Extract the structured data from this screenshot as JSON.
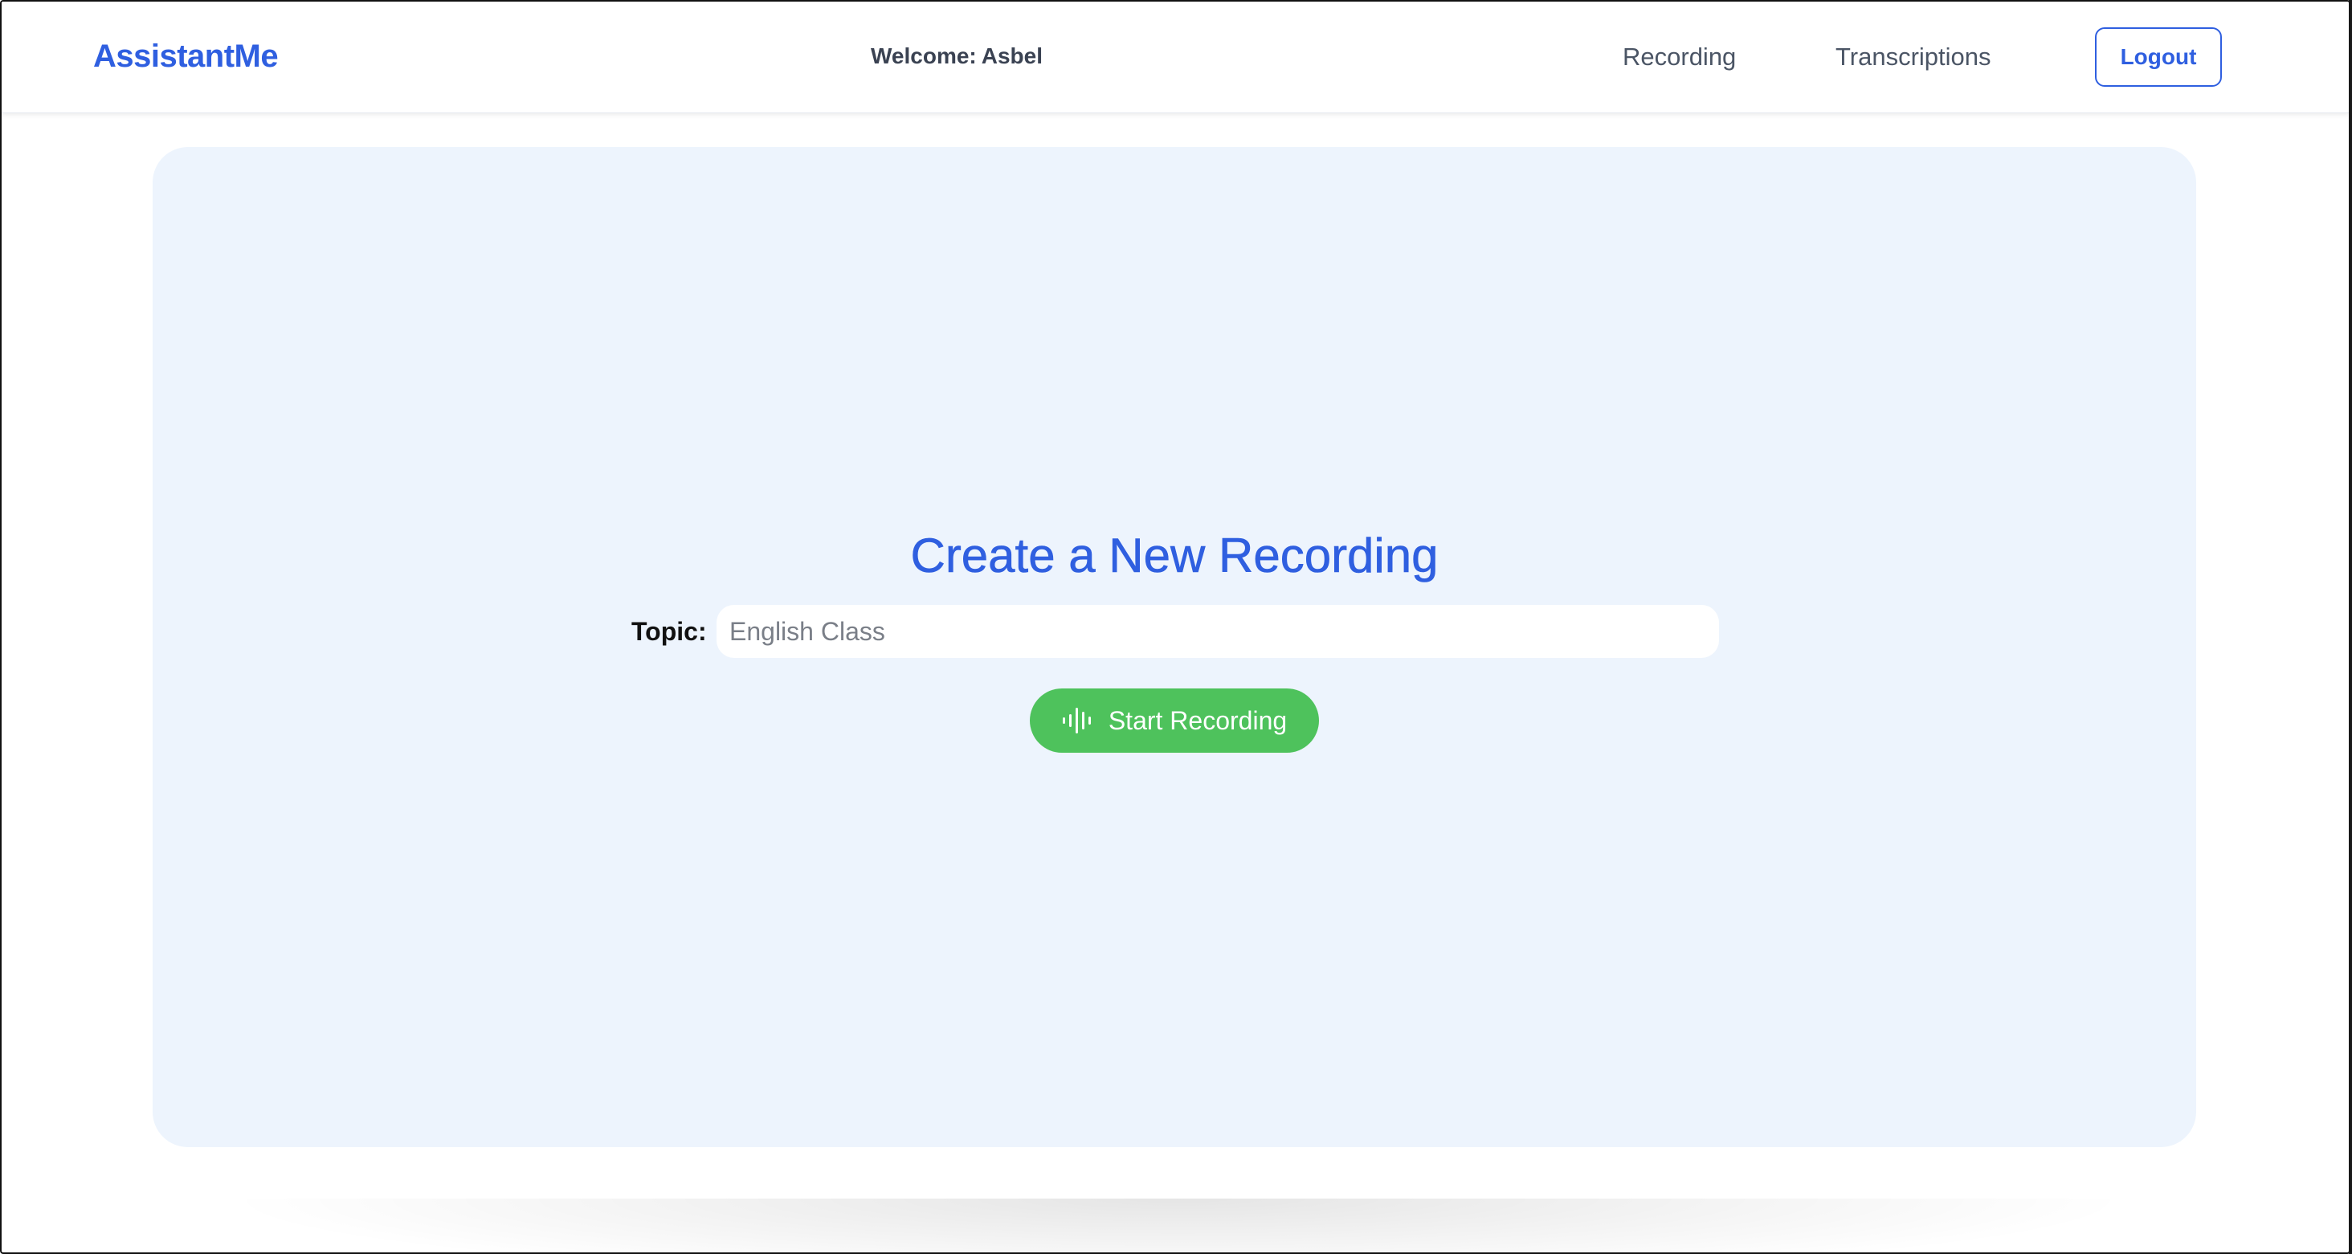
{
  "header": {
    "brand": "AssistantMe",
    "welcome_prefix": "Welcome:",
    "welcome_user": "Asbel",
    "nav": {
      "recording": "Recording",
      "transcriptions": "Transcriptions"
    },
    "logout_label": "Logout"
  },
  "main": {
    "title": "Create a New Recording",
    "topic_label": "Topic:",
    "topic_placeholder": "English Class",
    "topic_value": "",
    "start_button_label": "Start Recording",
    "start_button_icon": "audio-waveform-icon"
  },
  "colors": {
    "accent": "#2f5fe0",
    "card_bg": "#edf4fd",
    "start_button": "#4ec25c",
    "nav_text": "#4b5565"
  }
}
